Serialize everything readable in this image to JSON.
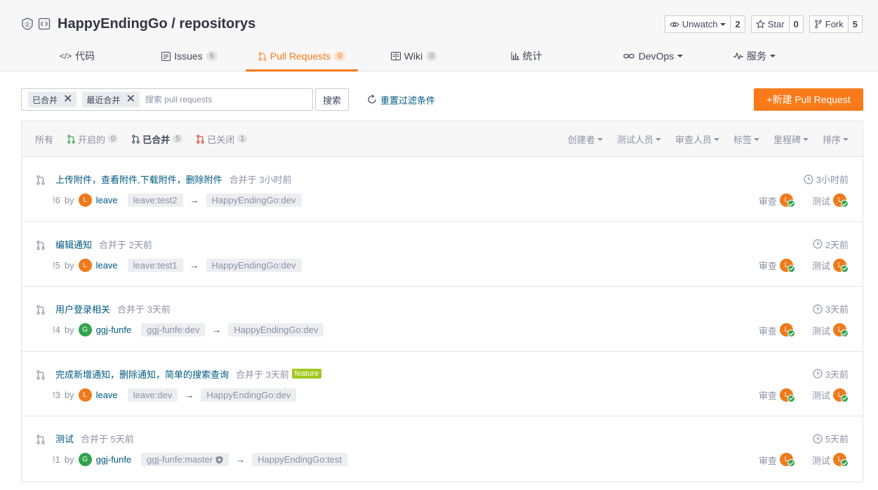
{
  "repo": {
    "owner": "HappyEndingGo",
    "sep": "/",
    "name": "repositorys"
  },
  "actions": [
    {
      "label": "Unwatch",
      "count": "2",
      "icon": "eye-icon"
    },
    {
      "label": "Star",
      "count": "0",
      "icon": "star-icon"
    },
    {
      "label": "Fork",
      "count": "5",
      "icon": "fork-icon"
    }
  ],
  "tabs": [
    {
      "label": "代码",
      "badge": ""
    },
    {
      "label": "Issues",
      "badge": "6"
    },
    {
      "label": "Pull Requests",
      "badge": "0"
    },
    {
      "label": "Wiki",
      "badge": "0"
    },
    {
      "label": "统计",
      "badge": ""
    },
    {
      "label": "DevOps",
      "badge": ""
    },
    {
      "label": "服务",
      "badge": ""
    }
  ],
  "toolbar": {
    "chips": [
      "已合并",
      "最近合并"
    ],
    "search_placeholder": "搜索 pull requests",
    "search_label": "搜索",
    "reset_label": "重置过滤条件",
    "new_pr_label": "+新建 Pull Request"
  },
  "states": {
    "all": "所有",
    "open": {
      "label": "开启的",
      "count": "0"
    },
    "merged": {
      "label": "已合并",
      "count": "5"
    },
    "closed": {
      "label": "已关闭",
      "count": "1"
    }
  },
  "dropdowns": [
    "创建者",
    "测试人员",
    "审查人员",
    "标签",
    "里程碑",
    "排序"
  ],
  "labels": {
    "by": "by",
    "review": "审查",
    "test": "测试",
    "arrow": "→"
  },
  "prs": [
    {
      "title": "上传附件，查看附件,下载附件，删除附件",
      "merged": "合并于 3小时前",
      "num": "!6",
      "author": "leave",
      "avatar": "L",
      "from": "leave:test2",
      "to": "HappyEndingGo:dev",
      "time": "3小时前",
      "label": ""
    },
    {
      "title": "编辑通知",
      "merged": "合并于 2天前",
      "num": "!5",
      "author": "leave",
      "avatar": "L",
      "from": "leave:test1",
      "to": "HappyEndingGo:dev",
      "time": "2天前",
      "label": ""
    },
    {
      "title": "用户登录相关",
      "merged": "合并于 3天前",
      "num": "!4",
      "author": "ggj-funfe",
      "avatar": "G",
      "from": "ggj-funfe:dev",
      "to": "HappyEndingGo:dev",
      "time": "3天前",
      "label": ""
    },
    {
      "title": "完成新增通知，删除通知，简单的搜索查询",
      "merged": "合并于 3天前",
      "num": "!3",
      "author": "leave",
      "avatar": "L",
      "from": "leave:dev",
      "to": "HappyEndingGo:dev",
      "time": "3天前",
      "label": "feature"
    },
    {
      "title": "测试",
      "merged": "合并于 5天前",
      "num": "!1",
      "author": "ggj-funfe",
      "avatar": "G",
      "from": "ggj-funfe:master",
      "to": "HappyEndingGo:test",
      "time": "5天前",
      "label": ""
    }
  ],
  "colors": {
    "accent": "#fa7a1a",
    "link": "#005980",
    "feature": "#a0c81e"
  }
}
